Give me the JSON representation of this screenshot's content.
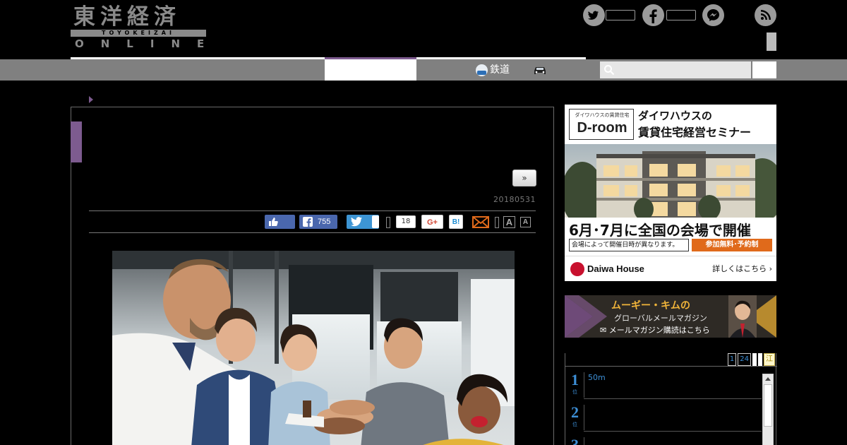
{
  "header": {
    "logo_kanji": "東洋経済",
    "logo_sub": "TOYOKEIZAI",
    "logo_online": "ONLINE",
    "social": [
      {
        "name": "twitter",
        "icon": "twitter-icon",
        "count": ""
      },
      {
        "name": "facebook",
        "icon": "facebook-icon",
        "count": ""
      },
      {
        "name": "messenger",
        "icon": "messenger-icon",
        "count": ""
      },
      {
        "name": "rss",
        "icon": "rss-icon",
        "count": ""
      }
    ]
  },
  "nav": {
    "rail_label": "鉄道",
    "rail_icon": "train-icon",
    "car_icon": "car-icon",
    "search_placeholder": "",
    "accent_color": "#7d5b8f"
  },
  "article": {
    "next_label": "»",
    "date": "20180531",
    "share": {
      "like_icon": "thumbs-up-icon",
      "facebook_count": "755",
      "twitter_icon": "twitter-icon",
      "pocket_count": "18",
      "gplus_label": "G+",
      "hatena_label": "B!",
      "mail_icon": "mail-icon",
      "font_large": "A",
      "font_small": "A"
    },
    "hero_alt": "photo"
  },
  "sidebar": {
    "ad1": {
      "brand_small": "ダイワハウスの賃貸住宅",
      "brand_big": "D-room",
      "title_line1": "ダイワハウスの",
      "title_line2": "賃貸住宅経営セミナー",
      "headline": "6月･7月に全国の会場で開催",
      "note": "会場によって開催日時が異なります。",
      "cta": "参加無料･予約制",
      "company": "Daiwa House",
      "more": "詳しくはこちら ›"
    },
    "ad2": {
      "title": "ムーギー・キムの",
      "subtitle": "グローバルメールマガジン",
      "cta": "✉ メールマガジン購読はこちら"
    },
    "ranking": {
      "tabs": [
        "1",
        "24",
        "",
        "",
        "江"
      ],
      "items": [
        {
          "rank": "1",
          "rank_sub": "位",
          "text": "50m"
        },
        {
          "rank": "2",
          "rank_sub": "位",
          "text": ""
        },
        {
          "rank": "3",
          "rank_sub": "位",
          "text": ""
        }
      ]
    }
  }
}
